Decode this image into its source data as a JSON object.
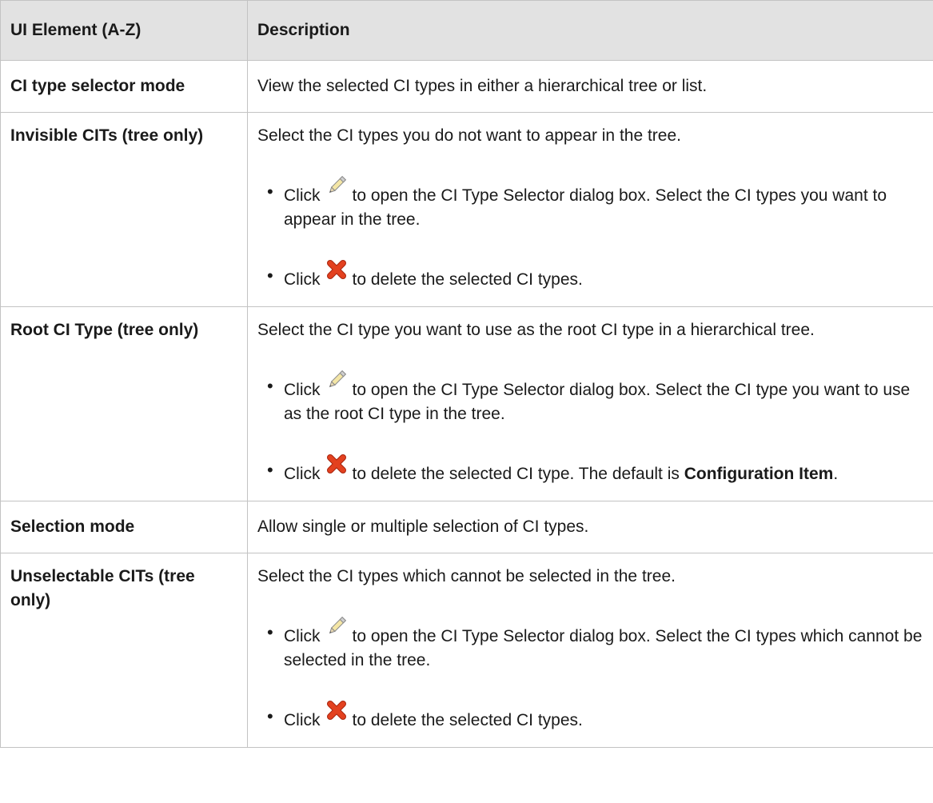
{
  "table": {
    "header": {
      "col1": "UI Element (A-Z)",
      "col2": "Description"
    },
    "rows": [
      {
        "name": "CI type selector mode",
        "description": "View the selected CI types in either a hierarchical tree or list."
      },
      {
        "name": "Invisible CITs (tree only)",
        "description": "Select the CI types you do not want to appear in the tree.",
        "bullets": [
          {
            "icon": "pencil-icon",
            "pre": "Click",
            "post": "to open the CI Type Selector dialog box. Select the CI types you want to appear in the tree."
          },
          {
            "icon": "delete-x-icon",
            "pre": "Click",
            "post": "to delete the selected CI types."
          }
        ]
      },
      {
        "name": "Root CI Type (tree only)",
        "description": "Select the CI type you want to use as the root CI type in a hierarchical tree.",
        "bullets": [
          {
            "icon": "pencil-icon",
            "pre": "Click",
            "post": "to open the CI Type Selector dialog box. Select the CI type you want to use as the root CI type in the tree."
          },
          {
            "icon": "delete-x-icon",
            "pre": "Click",
            "post": "to delete the selected CI type. The default is ",
            "strong": "Configuration Item",
            "tail": "."
          }
        ]
      },
      {
        "name": "Selection mode",
        "description": "Allow single or multiple selection of CI types."
      },
      {
        "name": "Unselectable CITs (tree only)",
        "description": "Select the CI types which cannot be selected in the tree.",
        "bullets": [
          {
            "icon": "pencil-icon",
            "pre": "Click",
            "post": "to open the CI Type Selector dialog box. Select the CI types which cannot be selected in the tree."
          },
          {
            "icon": "delete-x-icon",
            "pre": "Click",
            "post": "to delete the selected CI types."
          }
        ]
      }
    ]
  },
  "colors": {
    "header_bg": "#e2e2e2",
    "border": "#c3c3c3",
    "delete_icon": "#e3411f"
  }
}
